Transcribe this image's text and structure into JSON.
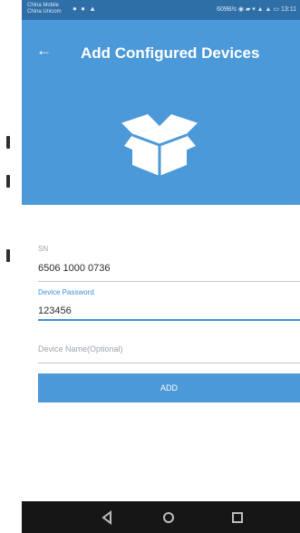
{
  "status_bar": {
    "carrier_line_1": "China Mobile",
    "carrier_line_2": "China Unicom",
    "speed": "609B/s",
    "time": "13:11"
  },
  "header": {
    "title": "Add Configured Devices",
    "back_icon": "back-arrow-icon",
    "hero_icon": "box-icon"
  },
  "form": {
    "sn": {
      "label": "SN",
      "value": "6506 1000 0736"
    },
    "device_password": {
      "label": "Device Password",
      "value": "123456"
    },
    "device_name": {
      "placeholder": "Device Name(Optional)"
    },
    "add_button": "ADD"
  },
  "colors": {
    "header_blue": "#4b99d8",
    "active_blue": "#3f91d9",
    "status_bar": "#2f6fa7",
    "nav_bar": "#161616"
  },
  "navigation": {
    "back_icon": "triangle-back-icon",
    "home_icon": "circle-home-icon",
    "recents_icon": "square-recents-icon"
  }
}
